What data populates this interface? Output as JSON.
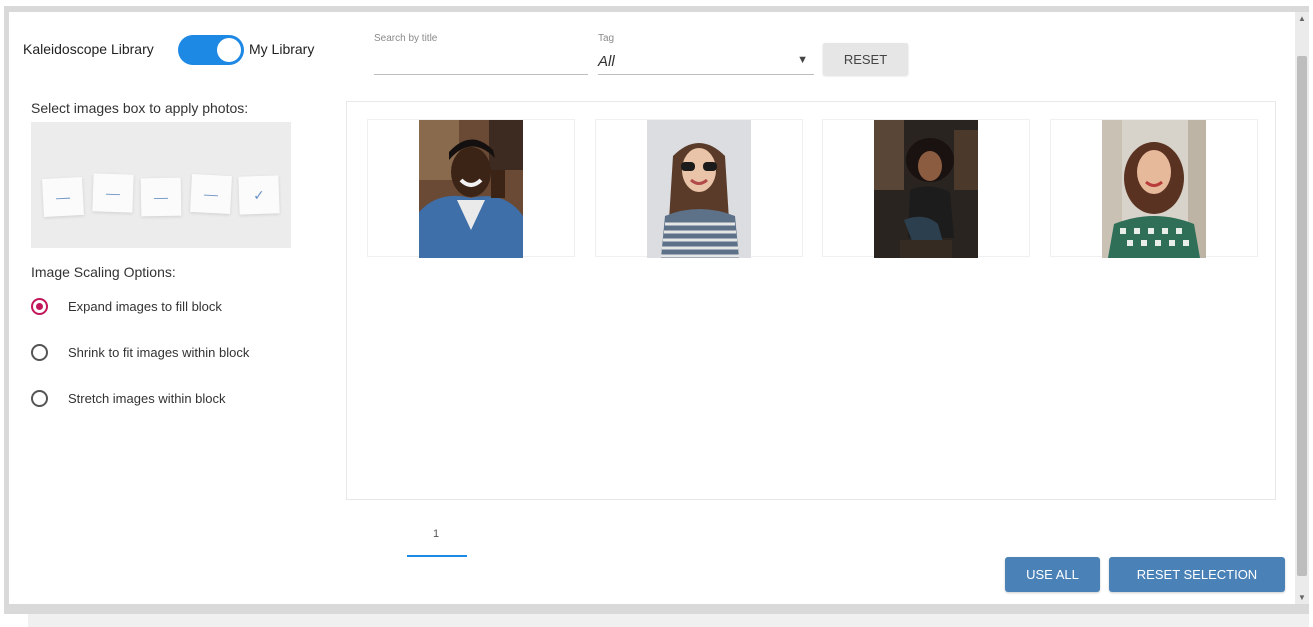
{
  "library_toggle": {
    "left_label": "Kaleidoscope Library",
    "right_label": "My Library",
    "state": "on",
    "accent": "#1e88e5"
  },
  "filters": {
    "search_label": "Search by title",
    "search_value": "",
    "tag_label": "Tag",
    "tag_value": "All",
    "reset_label": "RESET"
  },
  "options": {
    "select_heading": "Select images box to apply photos:",
    "slots": [
      {
        "icon": "dash-icon",
        "glyph": "—",
        "selected": false
      },
      {
        "icon": "dash-icon",
        "glyph": "—",
        "selected": false
      },
      {
        "icon": "dash-icon",
        "glyph": "—",
        "selected": false
      },
      {
        "icon": "dash-icon",
        "glyph": "—",
        "selected": false
      },
      {
        "icon": "check-icon",
        "glyph": "✓",
        "selected": true
      }
    ],
    "scaling_heading": "Image Scaling Options:",
    "scaling": [
      {
        "label": "Expand images to fill block",
        "checked": true
      },
      {
        "label": "Shrink to fit images within block",
        "checked": false
      },
      {
        "label": "Stretch images within block",
        "checked": false
      }
    ],
    "radio_color": "#c2185b"
  },
  "gallery": {
    "photos": [
      {
        "name": "photo-smiling-man-denim-jacket"
      },
      {
        "name": "photo-woman-sunglasses-striped-top"
      },
      {
        "name": "photo-woman-curly-hair-sitting"
      },
      {
        "name": "photo-woman-curly-hair-green-top"
      }
    ]
  },
  "pagination": {
    "current_page": "1"
  },
  "actions": {
    "use_all_label": "USE ALL",
    "reset_selection_label": "RESET SELECTION",
    "button_color": "#4a82b8"
  }
}
